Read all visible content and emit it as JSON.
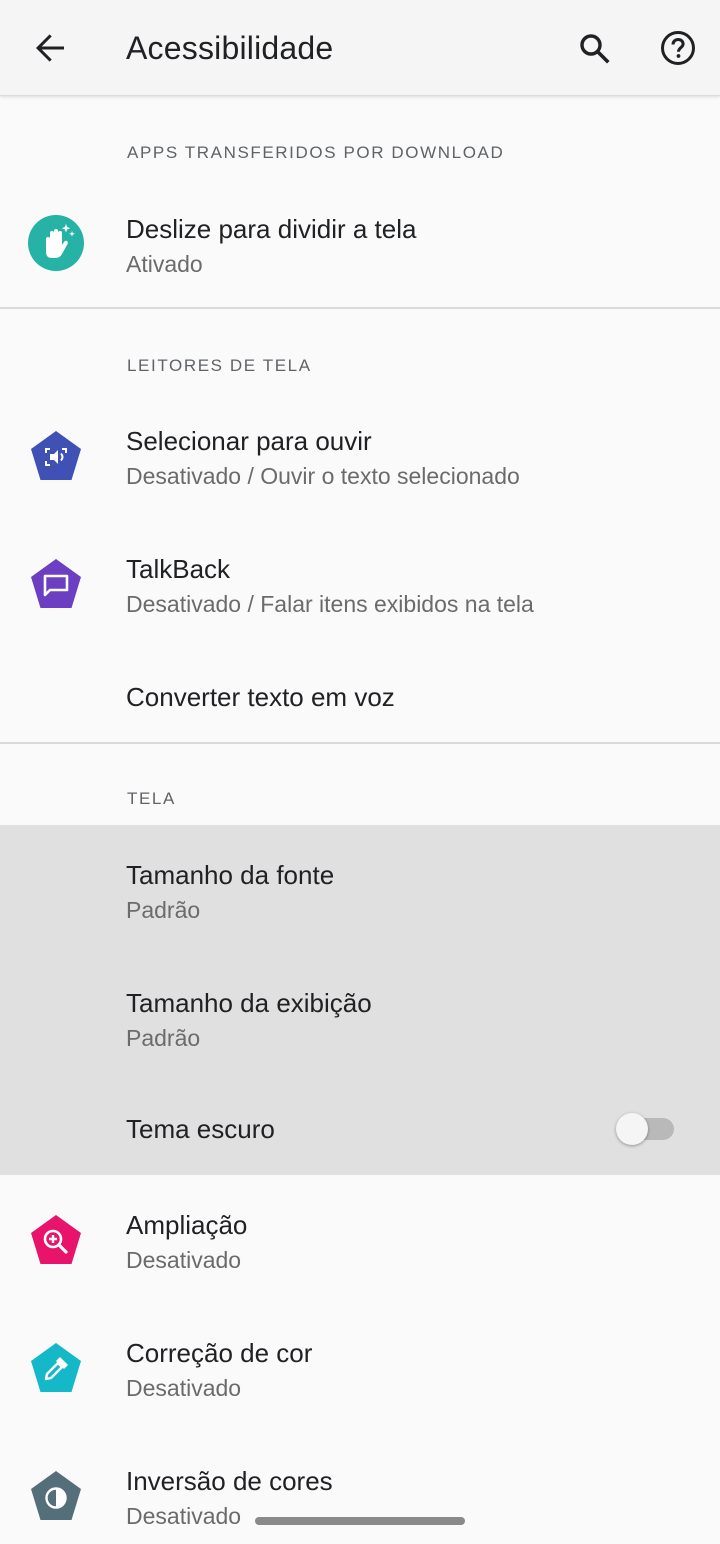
{
  "appbar": {
    "title": "Acessibilidade",
    "back_icon": "arrow-back-icon",
    "search_icon": "search-icon",
    "help_icon": "help-circle-icon"
  },
  "sections": {
    "downloaded": "APPS TRANSFERIDOS POR DOWNLOAD",
    "screen_readers": "LEITORES DE TELA",
    "display": "TELA"
  },
  "items": {
    "swipe_split": {
      "title": "Deslize para dividir a tela",
      "subtitle": "Ativado",
      "icon": "hand-sparkle-icon",
      "color": "#26b3a5"
    },
    "select_to_speak": {
      "title": "Selecionar para ouvir",
      "subtitle": "Desativado / Ouvir o texto selecionado",
      "icon": "speaker-select-icon",
      "color": "#3f51b5"
    },
    "talkback": {
      "title": "TalkBack",
      "subtitle": "Desativado / Falar itens exibidos na tela",
      "icon": "chat-bubble-icon",
      "color": "#6c3fc2"
    },
    "tts": {
      "title": "Converter texto em voz"
    },
    "font_size": {
      "title": "Tamanho da fonte",
      "subtitle": "Padrão"
    },
    "display_size": {
      "title": "Tamanho da exibição",
      "subtitle": "Padrão"
    },
    "dark_theme": {
      "title": "Tema escuro",
      "enabled": false
    },
    "magnification": {
      "title": "Ampliação",
      "subtitle": "Desativado",
      "icon": "magnify-plus-icon",
      "color": "#e8136a"
    },
    "color_correction": {
      "title": "Correção de cor",
      "subtitle": "Desativado",
      "icon": "eyedropper-icon",
      "color": "#14b8c8"
    },
    "color_inversion": {
      "title": "Inversão de cores",
      "subtitle": "Desativado",
      "icon": "contrast-icon",
      "color": "#546e7a"
    }
  },
  "colors": {
    "highlight": "#e0e0e0",
    "background": "#fafafa"
  }
}
